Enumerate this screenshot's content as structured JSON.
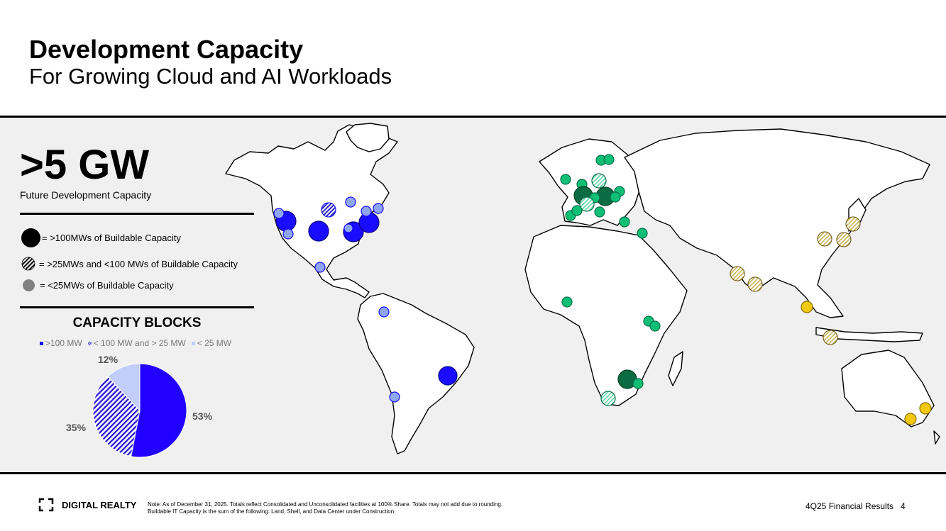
{
  "title": "Development Capacity",
  "subtitle": "For Growing Cloud and AI Workloads",
  "headline": {
    "value": ">5 GW",
    "caption": "Future Development Capacity"
  },
  "legend": {
    "large": "= >100MWs of Buildable Capacity",
    "medium": "= >25MWs and <100 MWs of Buildable Capacity",
    "small": "= <25MWs of Buildable Capacity"
  },
  "colors": {
    "americas": "#1a0dff",
    "americas_light": "#8fa6f5",
    "emea": "#0fbf76",
    "emea_dark": "#0b6b43",
    "apac_hatch": "#c9b055",
    "apac_small": "#f2c810",
    "accent": "#2200ff"
  },
  "chart_data": {
    "type": "pie",
    "title": "CAPACITY BLOCKS",
    "categories": [
      ">100 MW",
      "< 100 MW and > 25 MW",
      "< 25 MW"
    ],
    "values": [
      53,
      35,
      12
    ],
    "labels": [
      "53%",
      "35%",
      "12%"
    ],
    "legend_placement": "top"
  },
  "footer": {
    "brand": "DIGITAL REALTY",
    "note_line1": "Note: As of December 31, 2025. Totals reflect Consolidated and Unconsolidated facilities at 100% Share. Totals may not add due to rounding.",
    "note_line2": "Buildable IT Capacity is the sum of the following: Land, Shell, and Data Center under Construction.",
    "report": "4Q25 Financial Results",
    "page": "4"
  }
}
